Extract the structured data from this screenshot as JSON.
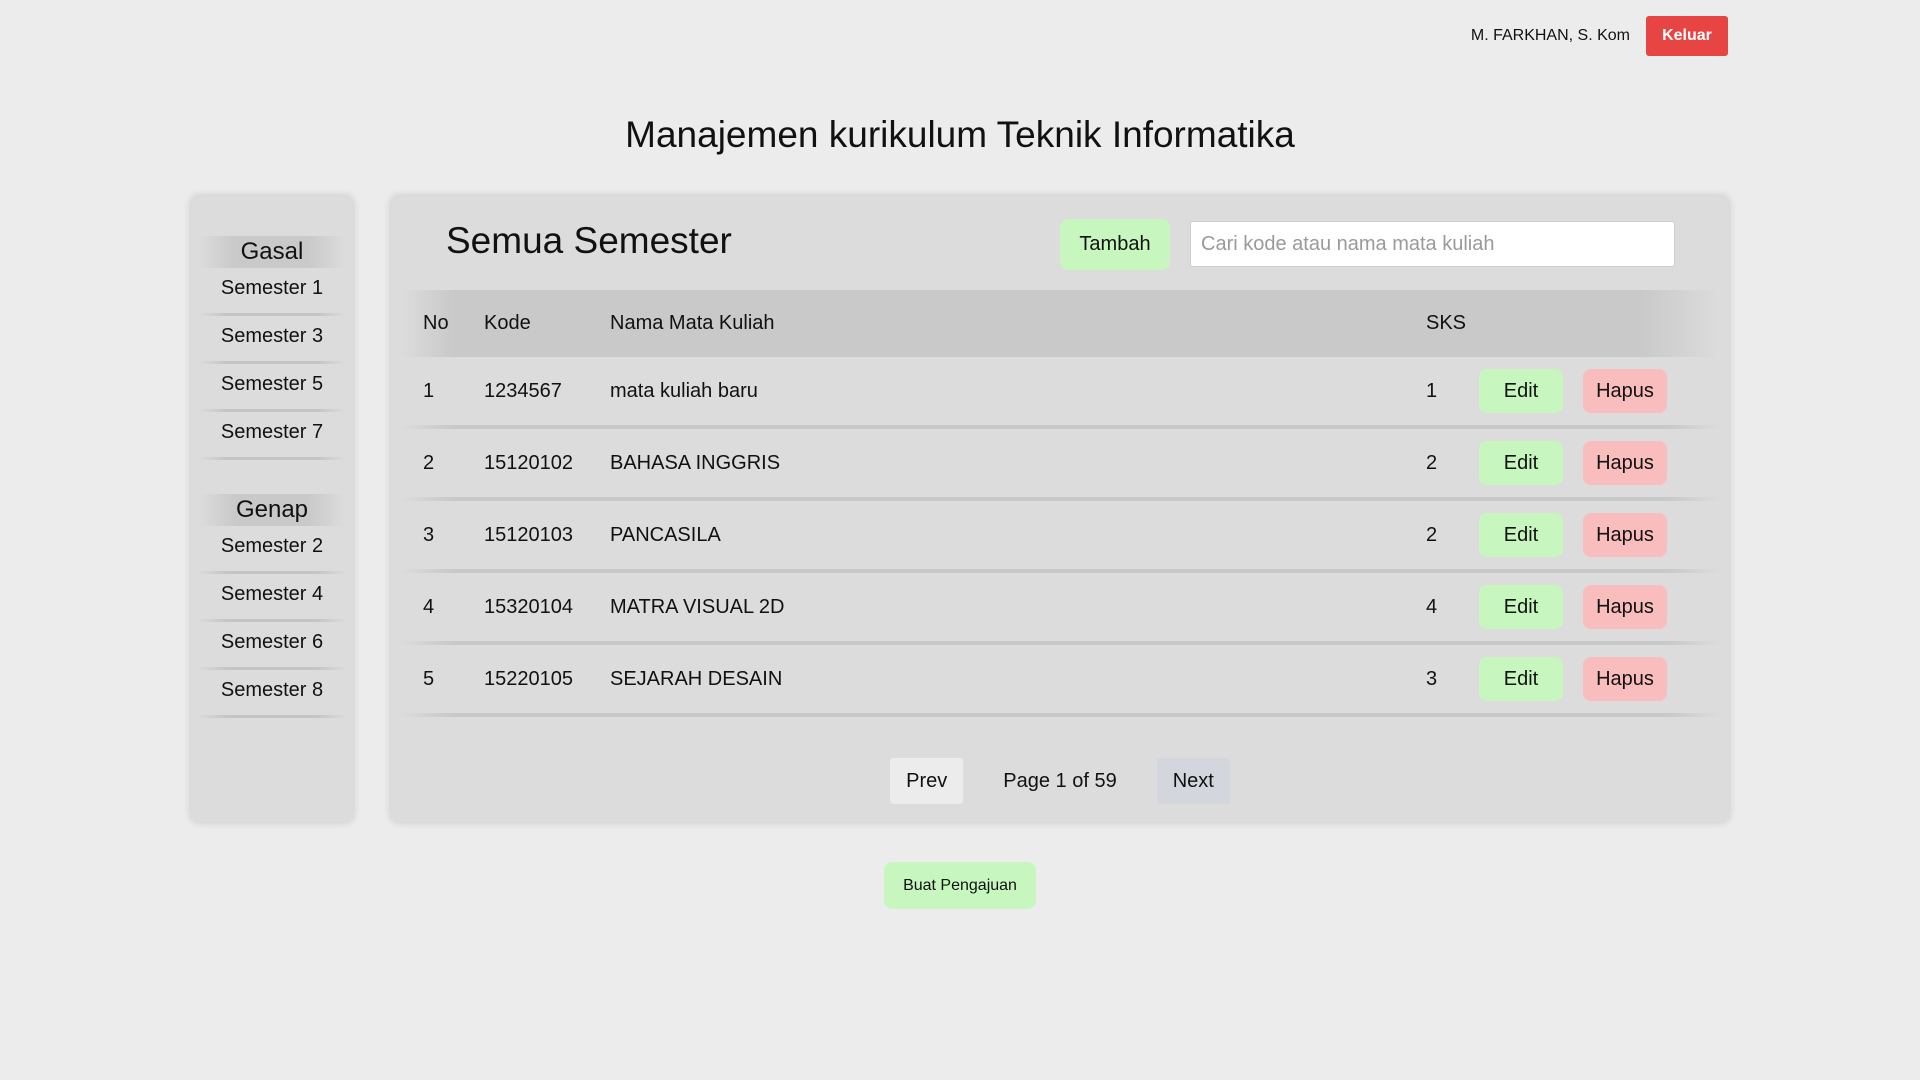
{
  "header": {
    "user_name": "M. FARKHAN, S. Kom",
    "logout_label": "Keluar",
    "page_title": "Manajemen kurikulum Teknik Informatika"
  },
  "sidebar": {
    "gasal_title": "Gasal",
    "gasal_items": [
      "Semester 1",
      "Semester 3",
      "Semester 5",
      "Semester 7"
    ],
    "genap_title": "Genap",
    "genap_items": [
      "Semester 2",
      "Semester 4",
      "Semester 6",
      "Semester 8"
    ]
  },
  "main": {
    "title": "Semua Semester",
    "add_label": "Tambah",
    "search_placeholder": "Cari kode atau nama mata kuliah",
    "columns": {
      "no": "No",
      "kode": "Kode",
      "nama": "Nama Mata Kuliah",
      "sks": "SKS"
    },
    "rows": [
      {
        "no": "1",
        "kode": "1234567",
        "nama": "mata kuliah baru",
        "sks": "1"
      },
      {
        "no": "2",
        "kode": "15120102",
        "nama": "BAHASA INGGRIS",
        "sks": "2"
      },
      {
        "no": "3",
        "kode": "15120103",
        "nama": "PANCASILA",
        "sks": "2"
      },
      {
        "no": "4",
        "kode": "15320104",
        "nama": "MATRA VISUAL 2D",
        "sks": "4"
      },
      {
        "no": "5",
        "kode": "15220105",
        "nama": "SEJARAH DESAIN",
        "sks": "3"
      }
    ],
    "edit_label": "Edit",
    "delete_label": "Hapus",
    "pagination": {
      "prev_label": "Prev",
      "page_info": "Page 1 of 59",
      "next_label": "Next"
    }
  },
  "footer": {
    "submit_label": "Buat Pengajuan"
  },
  "colors": {
    "logout": "#e74444",
    "positive": "#c7f7be",
    "danger": "#f9bdbd",
    "panel": "#dcdcdc",
    "background": "#ececec"
  }
}
